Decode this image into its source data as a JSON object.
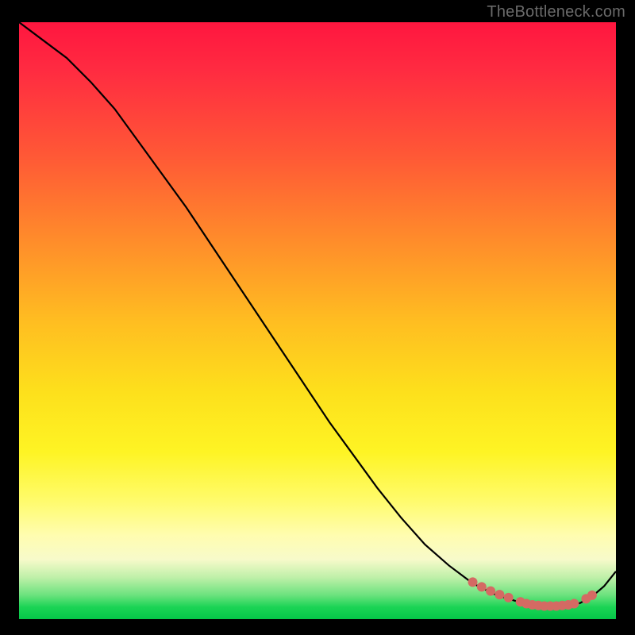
{
  "attribution": "TheBottleneck.com",
  "colors": {
    "frame_bg": "#000000",
    "dot": "#d46a63",
    "line": "#000000"
  },
  "chart_data": {
    "type": "line",
    "title": "",
    "xlabel": "",
    "ylabel": "",
    "xlim": [
      0,
      100
    ],
    "ylim": [
      0,
      100
    ],
    "x": [
      0,
      4,
      8,
      12,
      16,
      20,
      24,
      28,
      32,
      36,
      40,
      44,
      48,
      52,
      56,
      60,
      64,
      68,
      72,
      76,
      80,
      84,
      88,
      92,
      94,
      96,
      98,
      100
    ],
    "values": [
      100,
      97,
      94,
      90,
      85.5,
      80,
      74.5,
      69,
      63,
      57,
      51,
      45,
      39,
      33,
      27.5,
      22,
      17,
      12.5,
      9,
      6,
      4,
      2.8,
      2.2,
      2.2,
      2.7,
      3.8,
      5.5,
      8
    ],
    "highlight_points": [
      {
        "x": 76,
        "y": 6.2
      },
      {
        "x": 77.5,
        "y": 5.4
      },
      {
        "x": 79,
        "y": 4.7
      },
      {
        "x": 80.5,
        "y": 4.1
      },
      {
        "x": 82,
        "y": 3.6
      },
      {
        "x": 84,
        "y": 2.9
      },
      {
        "x": 85,
        "y": 2.6
      },
      {
        "x": 86,
        "y": 2.4
      },
      {
        "x": 87,
        "y": 2.3
      },
      {
        "x": 88,
        "y": 2.2
      },
      {
        "x": 89,
        "y": 2.2
      },
      {
        "x": 90,
        "y": 2.2
      },
      {
        "x": 91,
        "y": 2.3
      },
      {
        "x": 92,
        "y": 2.4
      },
      {
        "x": 93,
        "y": 2.6
      },
      {
        "x": 95,
        "y": 3.4
      },
      {
        "x": 96,
        "y": 4.0
      }
    ]
  }
}
